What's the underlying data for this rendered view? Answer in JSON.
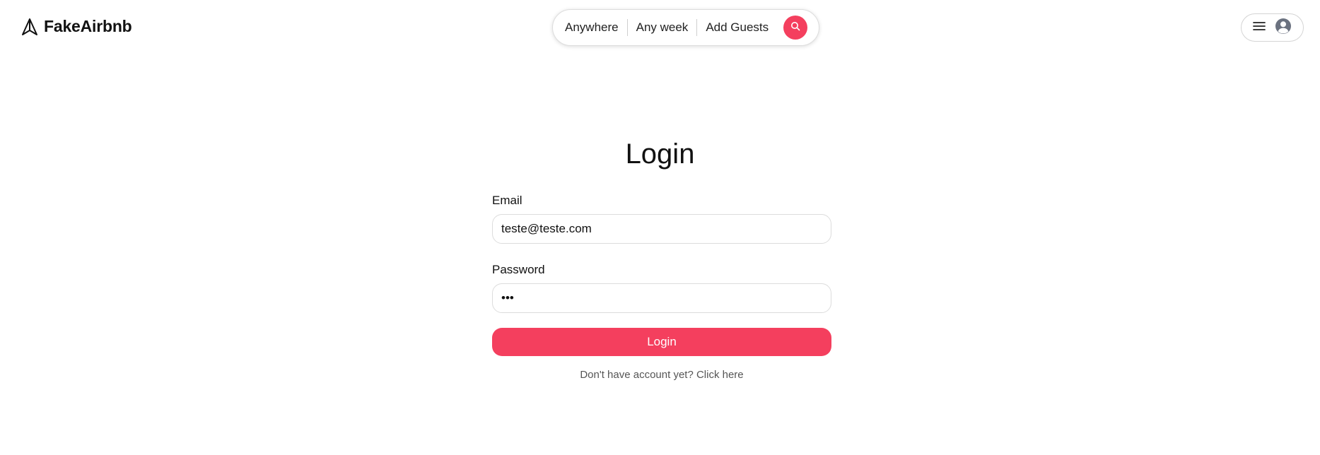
{
  "header": {
    "brand": "FakeAirbnb",
    "search": {
      "location": "Anywhere",
      "date": "Any week",
      "guests": "Add Guests",
      "button_icon": "search-icon"
    },
    "user_menu": {
      "menu_icon": "hamburger-menu-icon",
      "avatar_icon": "user-avatar-icon"
    }
  },
  "login": {
    "title": "Login",
    "email_label": "Email",
    "email_value": "teste@teste.com",
    "password_label": "Password",
    "password_value": "123",
    "submit_label": "Login",
    "signup_prompt": "Don't have account yet? Click here"
  },
  "colors": {
    "accent": "#f43f5e",
    "border": "#dddddd",
    "avatar": "#6b7280"
  }
}
